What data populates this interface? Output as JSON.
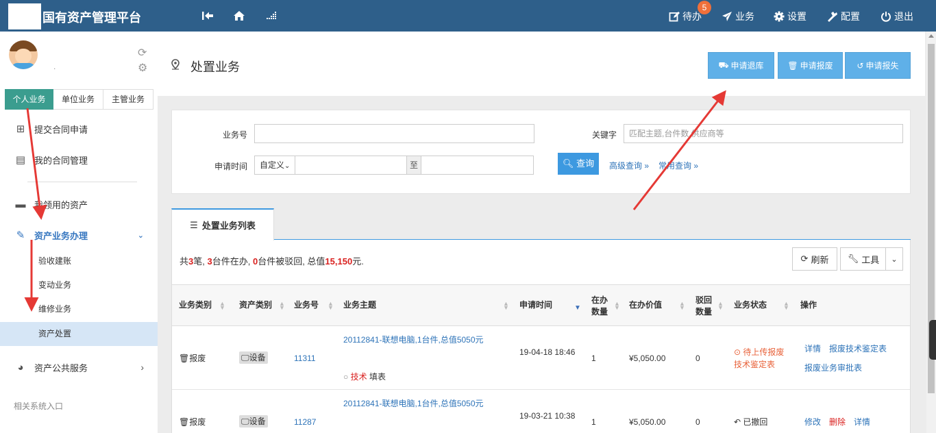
{
  "topbar": {
    "title": "国有资产管理平台",
    "badge": "5",
    "items": [
      {
        "icon": "edit-icon",
        "label": "待办"
      },
      {
        "icon": "paper-plane-icon",
        "label": "业务"
      },
      {
        "icon": "gear-icon",
        "label": "设置"
      },
      {
        "icon": "tools-icon",
        "label": "配置"
      },
      {
        "icon": "power-icon",
        "label": "退出"
      }
    ]
  },
  "sidebar": {
    "user_name": ".",
    "tabs": [
      "个人业务",
      "单位业务",
      "主管业务"
    ],
    "menu": [
      {
        "label": "提交合同申请"
      },
      {
        "label": "我的合同管理"
      },
      {
        "label": "我领用的资产"
      },
      {
        "label": "资产业务办理"
      },
      {
        "label": "资产公共服务"
      }
    ],
    "submenu": [
      "验收建账",
      "变动业务",
      "维修业务",
      "资产处置"
    ],
    "footer": "相关系统入口"
  },
  "header": {
    "title": "处置业务",
    "buttons": [
      "申请退库",
      "申请报废",
      "申请报失"
    ]
  },
  "search": {
    "label_no": "业务号",
    "label_keyword": "关键字",
    "keyword_placeholder": "匹配主题,台件数,供应商等",
    "label_time": "申请时间",
    "time_mode": "自定义",
    "to": "至",
    "query_button": "查询",
    "advanced": "高级查询 »",
    "common": "常用查询 »"
  },
  "list": {
    "tab": "处置业务列表",
    "summary": {
      "p1": "共",
      "total": "3",
      "p2": "笔, ",
      "active": "3",
      "p3": "台件在办, ",
      "rejected": "0",
      "p4": "台件被驳回, 总值",
      "value": "15,150",
      "p5": "元."
    },
    "refresh": "刷新",
    "tools": "工具",
    "columns": [
      "业务类别",
      "资产类别",
      "业务号",
      "业务主题",
      "申请时间",
      "在办数量",
      "在办价值",
      "驳回数量",
      "业务状态",
      "操作"
    ],
    "rows": [
      {
        "category": "报废",
        "asset_type": "设备",
        "no": "11311",
        "subject": "20112841-联想电脑,1台件,总值5050元",
        "step_role": "技术",
        "step_action": "填表",
        "time": "19-04-18 18:46",
        "qty": "1",
        "value": "¥5,050.00",
        "rejected": "0",
        "status": "待上传报废技术鉴定表",
        "actions": [
          "详情",
          "报废技术鉴定表",
          "报废业务审批表"
        ]
      },
      {
        "category": "报废",
        "asset_type": "设备",
        "no": "11287",
        "subject": "20112841-联想电脑,1台件,总值5050元",
        "time": "19-03-21 10:38",
        "qty": "1",
        "value": "¥5,050.00",
        "rejected": "0",
        "status": "已撤回",
        "actions": [
          "修改",
          "删除",
          "详情"
        ]
      }
    ]
  },
  "colors": {
    "topbar": "#2e5f8a",
    "accent": "#3d99e0",
    "tab_active": "#3b9d8f",
    "annotation_arrow": "#e53935"
  }
}
